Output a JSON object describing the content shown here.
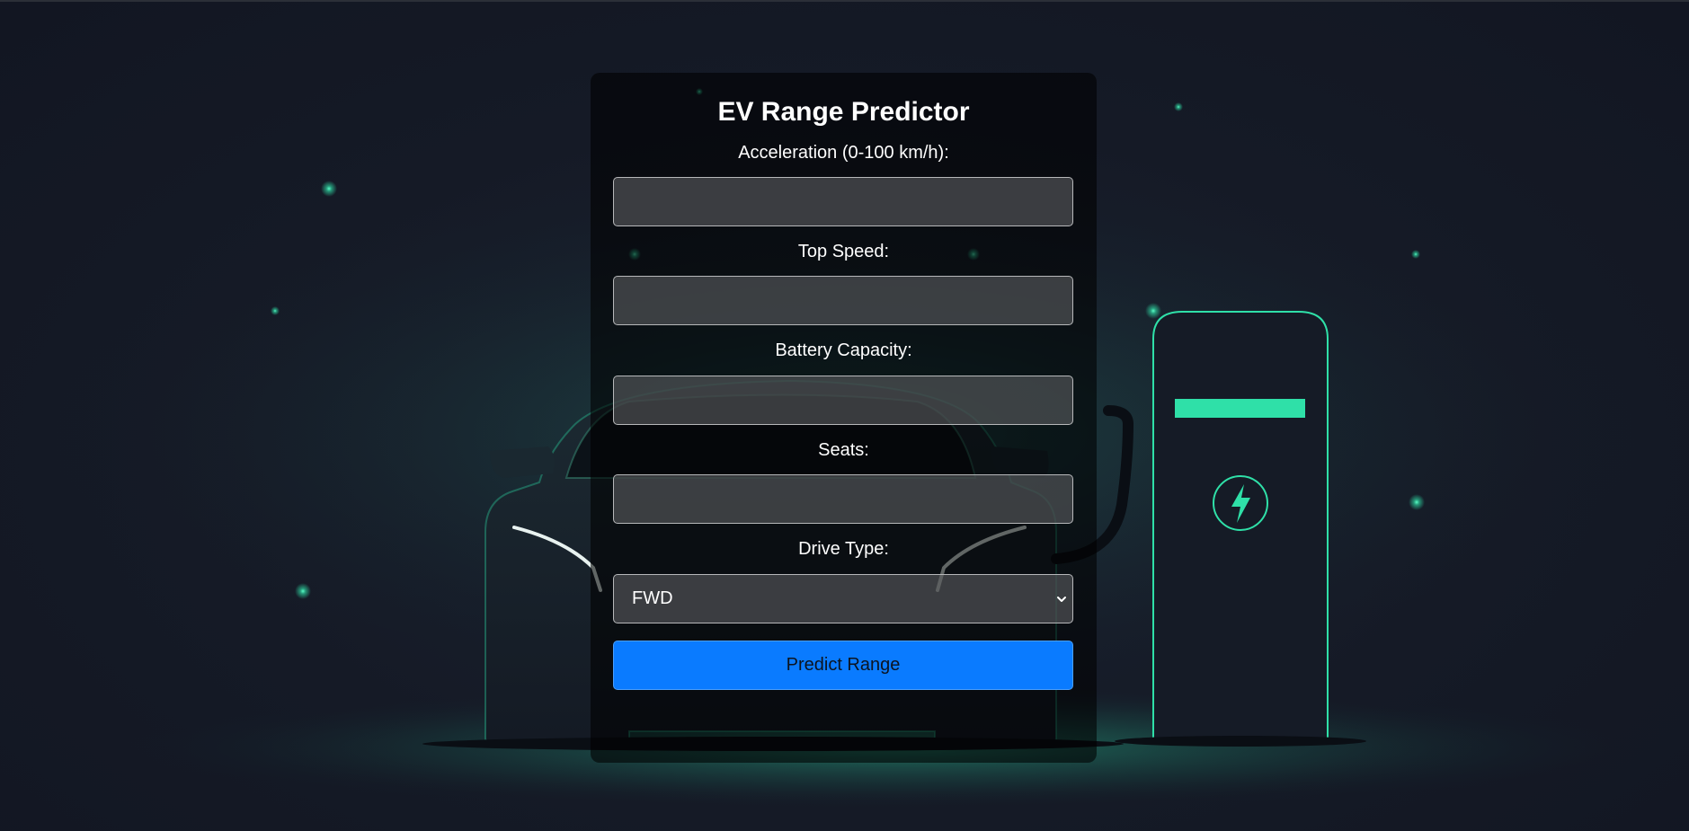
{
  "app": {
    "title": "EV Range Predictor"
  },
  "form": {
    "fields": [
      {
        "label": "Acceleration (0-100 km/h):",
        "value": ""
      },
      {
        "label": "Top Speed:",
        "value": ""
      },
      {
        "label": "Battery Capacity:",
        "value": ""
      },
      {
        "label": "Seats:",
        "value": ""
      }
    ],
    "drive_type": {
      "label": "Drive Type:",
      "selected": "FWD"
    },
    "submit_label": "Predict Range"
  },
  "icons": {
    "charger": "lightning-bolt-icon",
    "dropdown": "chevron-down-icon"
  },
  "colors": {
    "background": "#141824",
    "accent_glow": "#2fe0a8",
    "button": "#0a7bff"
  }
}
